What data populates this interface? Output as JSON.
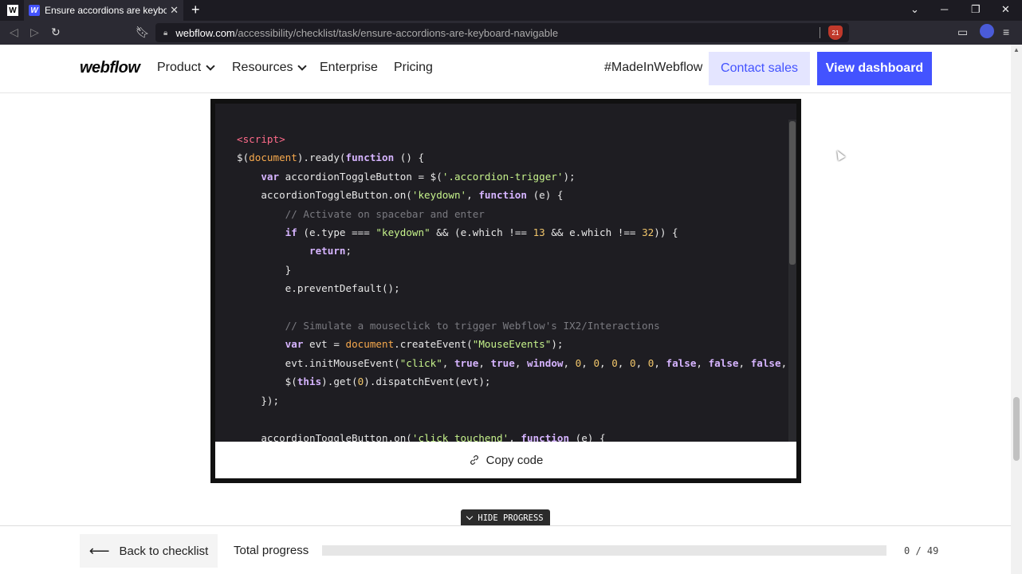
{
  "browser": {
    "tab_title": "Ensure accordions are keyboard n",
    "url_host": "webflow.com",
    "url_path": "/accessibility/checklist/task/ensure-accordions-are-keyboard-navigable",
    "shield_count": "21"
  },
  "nav": {
    "logo": "webflow",
    "items": [
      "Product",
      "Resources",
      "Enterprise",
      "Pricing"
    ],
    "made_in": "#MadeInWebflow",
    "contact": "Contact sales",
    "dashboard": "View dashboard"
  },
  "code": {
    "language": "javascript",
    "lines": [
      "<script>",
      "$(document).ready(function () {",
      "    var accordionToggleButton = $('.accordion-trigger');",
      "    accordionToggleButton.on('keydown', function (e) {",
      "        // Activate on spacebar and enter",
      "        if (e.type === \"keydown\" && (e.which !== 13 && e.which !== 32)) {",
      "            return;",
      "        }",
      "        e.preventDefault();",
      "",
      "        // Simulate a mouseclick to trigger Webflow's IX2/Interactions",
      "        var evt = document.createEvent(\"MouseEvents\");",
      "        evt.initMouseEvent(\"click\", true, true, window, 0, 0, 0, 0, 0, false, false, false, fa",
      "        $(this).get(0).dispatchEvent(evt);",
      "    });",
      "",
      "    accordionToggleButton.on('click touchend', function (e) {"
    ],
    "copy_label": "Copy code"
  },
  "progress": {
    "hide_label": "HIDE PROGRESS",
    "back_label": "Back to checklist",
    "total_label": "Total progress",
    "done": 0,
    "total": 49,
    "count_text": "0 / 49"
  }
}
